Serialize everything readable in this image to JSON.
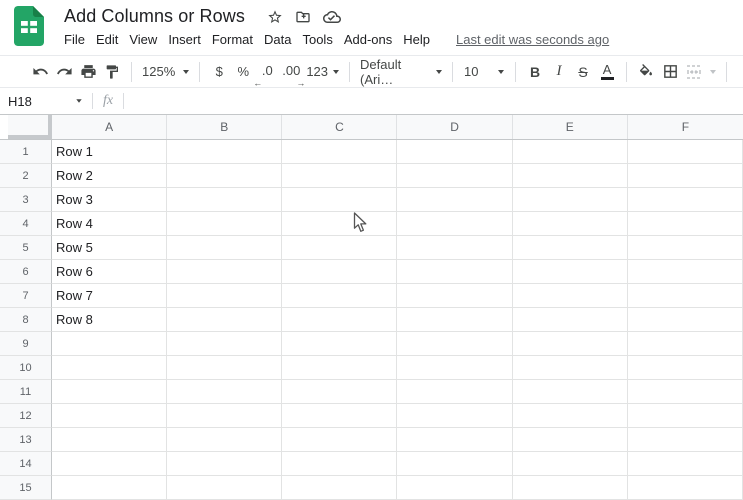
{
  "header": {
    "title": "Add Columns or Rows"
  },
  "menu": {
    "items": [
      "File",
      "Edit",
      "View",
      "Insert",
      "Format",
      "Data",
      "Tools",
      "Add-ons",
      "Help"
    ],
    "last_edit": "Last edit was seconds ago"
  },
  "toolbar": {
    "zoom": "125%",
    "currency": "$",
    "percent": "%",
    "decrease_decimals": ".0",
    "increase_decimals": ".00",
    "more_formats": "123",
    "font_name": "Default (Ari…",
    "font_size": "10",
    "bold": "B",
    "italic": "I",
    "strikethrough": "S",
    "text_color": "A"
  },
  "formula_bar": {
    "cell_reference": "H18",
    "fx_label": "fx",
    "formula_value": ""
  },
  "grid": {
    "column_headers": [
      "A",
      "B",
      "C",
      "D",
      "E",
      "F"
    ],
    "rows": [
      {
        "num": "1",
        "a": "Row 1"
      },
      {
        "num": "2",
        "a": "Row 2"
      },
      {
        "num": "3",
        "a": "Row 3"
      },
      {
        "num": "4",
        "a": "Row 4"
      },
      {
        "num": "5",
        "a": "Row 5"
      },
      {
        "num": "6",
        "a": "Row 6"
      },
      {
        "num": "7",
        "a": "Row 7"
      },
      {
        "num": "8",
        "a": "Row 8"
      },
      {
        "num": "9",
        "a": ""
      },
      {
        "num": "10",
        "a": ""
      },
      {
        "num": "11",
        "a": ""
      },
      {
        "num": "12",
        "a": ""
      },
      {
        "num": "13",
        "a": ""
      },
      {
        "num": "14",
        "a": ""
      },
      {
        "num": "15",
        "a": ""
      }
    ]
  },
  "colors": {
    "sheets_green": "#23a566",
    "sheets_green_dark": "#188048",
    "toolbar_icon": "#444746",
    "muted_text": "#5f6368",
    "grid_line": "#e2e3e3",
    "header_bg": "#f8f9fa"
  }
}
